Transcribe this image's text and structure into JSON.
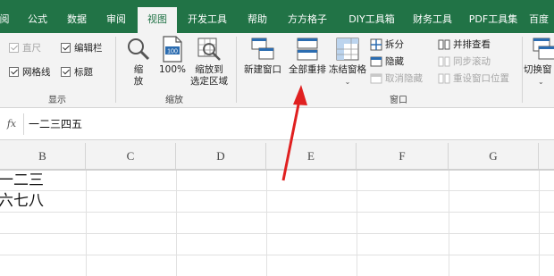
{
  "tabs": [
    {
      "label": "阅"
    },
    {
      "label": "公式"
    },
    {
      "label": "数据"
    },
    {
      "label": "审阅"
    },
    {
      "label": "视图"
    },
    {
      "label": "开发工具"
    },
    {
      "label": "帮助"
    },
    {
      "label": "方方格子"
    },
    {
      "label": "DIY工具箱"
    },
    {
      "label": "财务工具"
    },
    {
      "label": "PDF工具集"
    },
    {
      "label": "百度"
    }
  ],
  "show_group": {
    "label": "显示",
    "items": [
      {
        "label": "直尺",
        "checked": true,
        "disabled": true
      },
      {
        "label": "编辑栏",
        "checked": true,
        "disabled": false
      },
      {
        "label": "网格线",
        "checked": true,
        "disabled": false
      },
      {
        "label": "标题",
        "checked": true,
        "disabled": false
      }
    ]
  },
  "zoom_group": {
    "label": "缩放",
    "zoom_label": "缩\n放",
    "zoom_line1": "缩",
    "zoom_line2": "放",
    "percent_label": "100%",
    "zoom_sel_line1": "缩放到",
    "zoom_sel_line2": "选定区域",
    "percent_icon_text": "100"
  },
  "window_group": {
    "label": "窗口",
    "new_window": "新建窗口",
    "arrange_all": "全部重排",
    "freeze_panes": "冻结窗格",
    "split": "拆分",
    "hide": "隐藏",
    "unhide": "取消隐藏",
    "side_by_side": "并排查看",
    "sync_scroll": "同步滚动",
    "reset_position": "重设窗口位置",
    "switch_window": "切换窗"
  },
  "formula_bar": {
    "fx": "fx",
    "value": "一二三四五"
  },
  "columns": [
    "B",
    "C",
    "D",
    "E",
    "F",
    "G"
  ],
  "cells": {
    "b1": "一二三",
    "b2": "六七八"
  },
  "colors": {
    "accent": "#217346",
    "arrow": "#e02020"
  }
}
